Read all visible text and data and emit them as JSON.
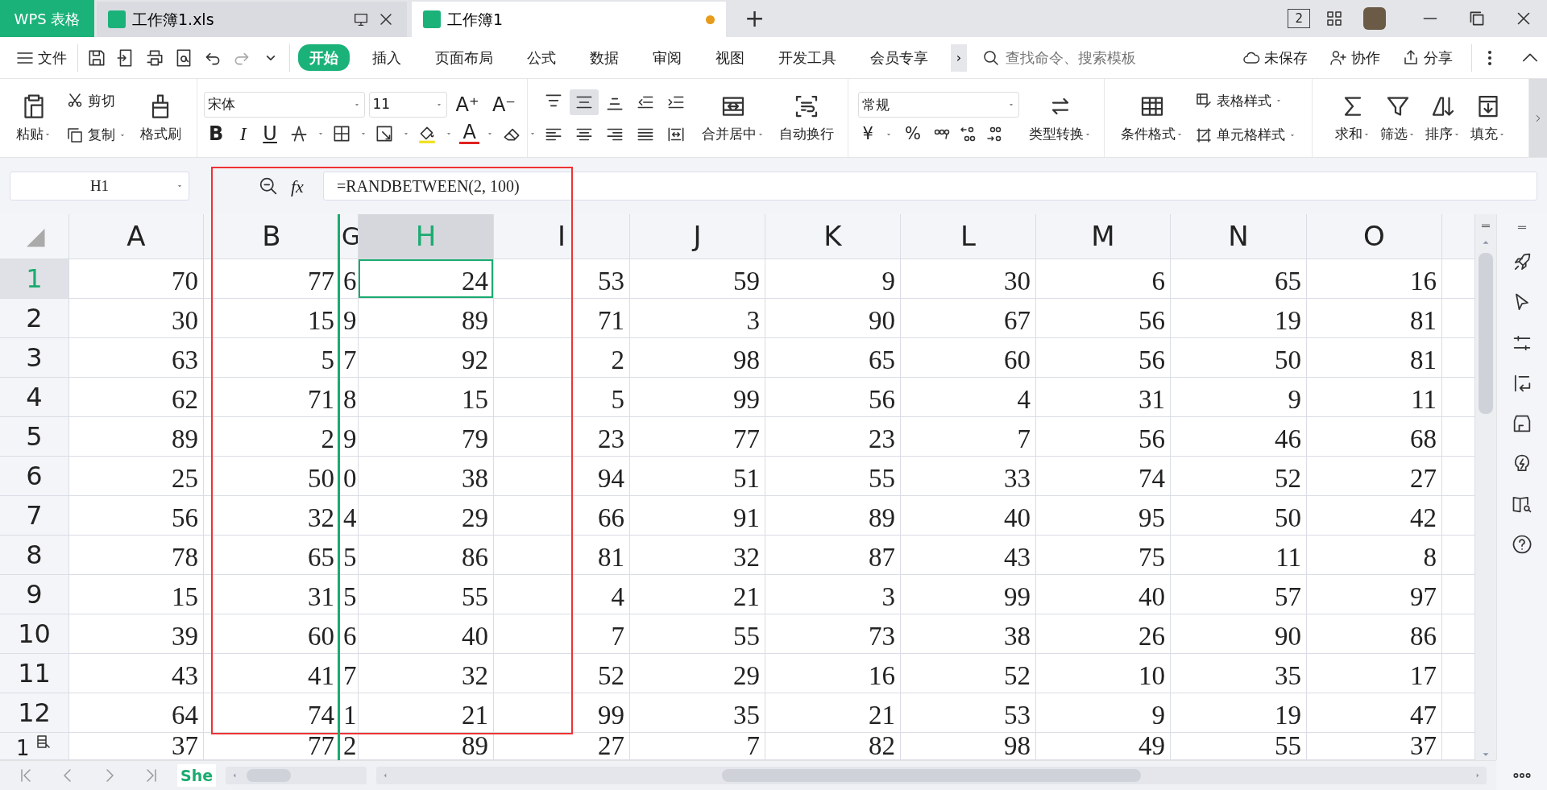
{
  "title_bar": {
    "app": "WPS 表格",
    "doc_tabs": [
      {
        "label": "工作簿1.xls",
        "selected": false,
        "modified": false
      },
      {
        "label": "工作簿1",
        "selected": true,
        "modified": true
      }
    ],
    "new_tab": "+",
    "window_count": "2"
  },
  "menu": {
    "file": "文件",
    "tabs": [
      {
        "label": "开始",
        "selected": true
      },
      {
        "label": "插入",
        "selected": false
      },
      {
        "label": "页面布局",
        "selected": false
      },
      {
        "label": "公式",
        "selected": false
      },
      {
        "label": "数据",
        "selected": false
      },
      {
        "label": "审阅",
        "selected": false
      },
      {
        "label": "视图",
        "selected": false
      },
      {
        "label": "开发工具",
        "selected": false
      },
      {
        "label": "会员专享",
        "selected": false
      }
    ],
    "more": "›",
    "search": {
      "placeholder": "查找命令、搜索模板"
    },
    "actions": [
      {
        "kind": "cloud",
        "label": "未保存"
      },
      {
        "kind": "collab",
        "label": "协作"
      },
      {
        "kind": "share",
        "label": "分享"
      }
    ]
  },
  "ribbon": {
    "clipboard": {
      "paste": "粘贴",
      "cut": "剪切",
      "copy": "复制",
      "painter": "格式刷"
    },
    "font": {
      "name": "宋体",
      "size": "11",
      "grow": "A⁺",
      "shrink": "A⁻",
      "bold": "B",
      "italic": "I",
      "underline": "U",
      "font_color": "A"
    },
    "align_buttons": [
      {
        "kind": "top",
        "selected": false
      },
      {
        "kind": "middle",
        "selected": true
      },
      {
        "kind": "bottom",
        "selected": false
      },
      {
        "kind": "outdent",
        "selected": false
      },
      {
        "kind": "indent",
        "selected": false
      },
      {
        "kind": "left",
        "selected": false
      },
      {
        "kind": "center",
        "selected": false
      },
      {
        "kind": "right",
        "selected": false
      },
      {
        "kind": "justify",
        "selected": false
      },
      {
        "kind": "distributed",
        "selected": false
      }
    ],
    "merge": "合并居中",
    "wrap": "自动换行",
    "number": {
      "format": "常规",
      "currency": "¥",
      "percent": "%",
      "convert": "类型转换"
    },
    "styles": {
      "conditional": "条件格式",
      "table_style": "表格样式",
      "cell_style": "单元格样式"
    },
    "editing": [
      {
        "kind": "sum",
        "label": "求和"
      },
      {
        "kind": "filter",
        "label": "筛选"
      },
      {
        "kind": "sort",
        "label": "排序"
      },
      {
        "kind": "fill",
        "label": "填充"
      }
    ]
  },
  "formula_bar": {
    "name_box": "H1",
    "fx": "fx",
    "formula": "=RANDBETWEEN(2, 100)"
  },
  "sheet": {
    "columns": [
      {
        "label": "A",
        "selected": false
      },
      {
        "label": "B",
        "selected": false
      },
      {
        "label": "G",
        "selected": false
      },
      {
        "label": "H",
        "selected": true
      },
      {
        "label": "I",
        "selected": false
      },
      {
        "label": "J",
        "selected": false
      },
      {
        "label": "K",
        "selected": false
      },
      {
        "label": "L",
        "selected": false
      },
      {
        "label": "M",
        "selected": false
      },
      {
        "label": "N",
        "selected": false
      },
      {
        "label": "O",
        "selected": false
      }
    ],
    "rows": [
      {
        "label": "1",
        "selected": true,
        "cells": [
          "70",
          "77",
          "6",
          "24",
          "53",
          "59",
          "9",
          "30",
          "6",
          "65",
          "16"
        ]
      },
      {
        "label": "2",
        "selected": false,
        "cells": [
          "30",
          "15",
          "9",
          "89",
          "71",
          "3",
          "90",
          "67",
          "56",
          "19",
          "81"
        ]
      },
      {
        "label": "3",
        "selected": false,
        "cells": [
          "63",
          "5",
          "7",
          "92",
          "2",
          "98",
          "65",
          "60",
          "56",
          "50",
          "81"
        ]
      },
      {
        "label": "4",
        "selected": false,
        "cells": [
          "62",
          "71",
          "8",
          "15",
          "5",
          "99",
          "56",
          "4",
          "31",
          "9",
          "11"
        ]
      },
      {
        "label": "5",
        "selected": false,
        "cells": [
          "89",
          "2",
          "9",
          "79",
          "23",
          "77",
          "23",
          "7",
          "56",
          "46",
          "68"
        ]
      },
      {
        "label": "6",
        "selected": false,
        "cells": [
          "25",
          "50",
          "0",
          "38",
          "94",
          "51",
          "55",
          "33",
          "74",
          "52",
          "27"
        ]
      },
      {
        "label": "7",
        "selected": false,
        "cells": [
          "56",
          "32",
          "4",
          "29",
          "66",
          "91",
          "89",
          "40",
          "95",
          "50",
          "42"
        ]
      },
      {
        "label": "8",
        "selected": false,
        "cells": [
          "78",
          "65",
          "5",
          "86",
          "81",
          "32",
          "87",
          "43",
          "75",
          "11",
          "8"
        ]
      },
      {
        "label": "9",
        "selected": false,
        "cells": [
          "15",
          "31",
          "5",
          "55",
          "4",
          "21",
          "3",
          "99",
          "40",
          "57",
          "97"
        ]
      },
      {
        "label": "10",
        "selected": false,
        "cells": [
          "39",
          "60",
          "6",
          "40",
          "7",
          "55",
          "73",
          "38",
          "26",
          "90",
          "86"
        ]
      },
      {
        "label": "11",
        "selected": false,
        "cells": [
          "43",
          "41",
          "7",
          "32",
          "52",
          "29",
          "16",
          "52",
          "10",
          "35",
          "17"
        ]
      },
      {
        "label": "12",
        "selected": false,
        "cells": [
          "64",
          "74",
          "1",
          "21",
          "99",
          "35",
          "21",
          "53",
          "9",
          "19",
          "47"
        ]
      },
      {
        "label": "1",
        "selected": false,
        "cells": [
          "37",
          "77",
          "2",
          "89",
          "27",
          "7",
          "82",
          "98",
          "49",
          "55",
          "37"
        ]
      }
    ]
  },
  "sheet_tabs": [
    {
      "label": "She",
      "selected": true
    }
  ]
}
